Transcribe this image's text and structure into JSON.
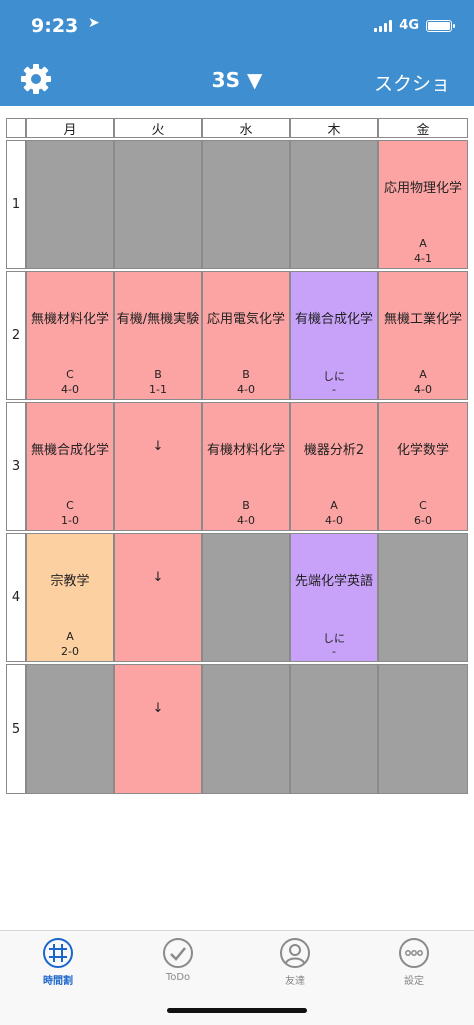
{
  "status": {
    "time": "9:23",
    "network": "4G"
  },
  "header": {
    "title": "3S ▼",
    "screenshot_label": "スクショ"
  },
  "days": [
    "月",
    "火",
    "水",
    "木",
    "金"
  ],
  "periods": [
    "1",
    "2",
    "3",
    "4",
    "5"
  ],
  "grid": [
    [
      {
        "color": "gray",
        "name": "",
        "room": "",
        "count": ""
      },
      {
        "color": "gray",
        "name": "",
        "room": "",
        "count": ""
      },
      {
        "color": "gray",
        "name": "",
        "room": "",
        "count": ""
      },
      {
        "color": "gray",
        "name": "",
        "room": "",
        "count": ""
      },
      {
        "color": "red",
        "name": "応用物理化学",
        "room": "A",
        "count": "4-1"
      }
    ],
    [
      {
        "color": "red",
        "name": "無機材料化学",
        "room": "C",
        "count": "4-0"
      },
      {
        "color": "red",
        "name": "有機/無機実験",
        "room": "B",
        "count": "1-1"
      },
      {
        "color": "red",
        "name": "応用電気化学",
        "room": "B",
        "count": "4-0"
      },
      {
        "color": "purple",
        "name": "有機合成化学",
        "room": "しに",
        "count": "-"
      },
      {
        "color": "red",
        "name": "無機工業化学",
        "room": "A",
        "count": "4-0"
      }
    ],
    [
      {
        "color": "red",
        "name": "無機合成化学",
        "room": "C",
        "count": "1-0"
      },
      {
        "color": "red",
        "name": "↓",
        "room": "",
        "count": ""
      },
      {
        "color": "red",
        "name": "有機材料化学",
        "room": "B",
        "count": "4-0"
      },
      {
        "color": "red",
        "name": "機器分析2",
        "room": "A",
        "count": "4-0"
      },
      {
        "color": "red",
        "name": "化学数学",
        "room": "C",
        "count": "6-0"
      }
    ],
    [
      {
        "color": "orange",
        "name": "宗教学",
        "room": "A",
        "count": "2-0"
      },
      {
        "color": "red",
        "name": "↓",
        "room": "",
        "count": ""
      },
      {
        "color": "gray",
        "name": "",
        "room": "",
        "count": ""
      },
      {
        "color": "purple",
        "name": "先端化学英語",
        "room": "しに",
        "count": "-"
      },
      {
        "color": "gray",
        "name": "",
        "room": "",
        "count": ""
      }
    ],
    [
      {
        "color": "gray",
        "name": "",
        "room": "",
        "count": ""
      },
      {
        "color": "red",
        "name": "↓",
        "room": "",
        "count": ""
      },
      {
        "color": "gray",
        "name": "",
        "room": "",
        "count": ""
      },
      {
        "color": "gray",
        "name": "",
        "room": "",
        "count": ""
      },
      {
        "color": "gray",
        "name": "",
        "room": "",
        "count": ""
      }
    ]
  ],
  "tabs": [
    {
      "label": "時間割",
      "icon": "timetable-icon",
      "active": true
    },
    {
      "label": "ToDo",
      "icon": "todo-check-icon",
      "active": false
    },
    {
      "label": "友達",
      "icon": "friends-icon",
      "active": false
    },
    {
      "label": "設定",
      "icon": "settings-dots-icon",
      "active": false
    }
  ],
  "colors": {
    "header": "#3e8ed0",
    "red": "#fca4a4",
    "gray": "#a0a0a0",
    "purple": "#c8a2f9",
    "orange": "#fdd0a2",
    "active_tab": "#1a66cc"
  }
}
